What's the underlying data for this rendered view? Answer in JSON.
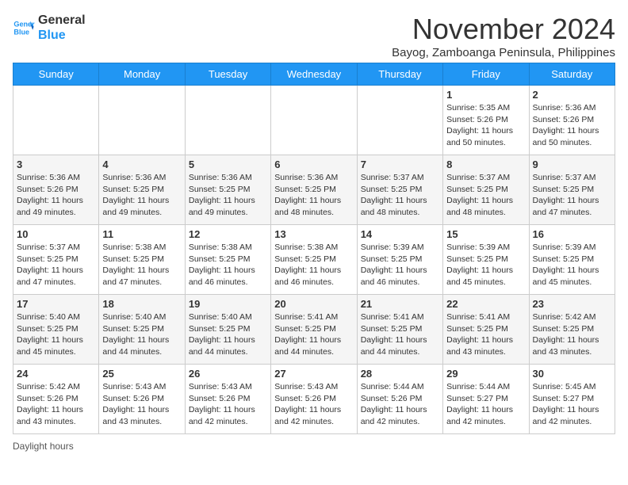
{
  "logo": {
    "line1": "General",
    "line2": "Blue"
  },
  "title": "November 2024",
  "subtitle": "Bayog, Zamboanga Peninsula, Philippines",
  "days_of_week": [
    "Sunday",
    "Monday",
    "Tuesday",
    "Wednesday",
    "Thursday",
    "Friday",
    "Saturday"
  ],
  "weeks": [
    [
      {
        "day": "",
        "info": ""
      },
      {
        "day": "",
        "info": ""
      },
      {
        "day": "",
        "info": ""
      },
      {
        "day": "",
        "info": ""
      },
      {
        "day": "",
        "info": ""
      },
      {
        "day": "1",
        "info": "Sunrise: 5:35 AM\nSunset: 5:26 PM\nDaylight: 11 hours\nand 50 minutes."
      },
      {
        "day": "2",
        "info": "Sunrise: 5:36 AM\nSunset: 5:26 PM\nDaylight: 11 hours\nand 50 minutes."
      }
    ],
    [
      {
        "day": "3",
        "info": "Sunrise: 5:36 AM\nSunset: 5:26 PM\nDaylight: 11 hours\nand 49 minutes."
      },
      {
        "day": "4",
        "info": "Sunrise: 5:36 AM\nSunset: 5:25 PM\nDaylight: 11 hours\nand 49 minutes."
      },
      {
        "day": "5",
        "info": "Sunrise: 5:36 AM\nSunset: 5:25 PM\nDaylight: 11 hours\nand 49 minutes."
      },
      {
        "day": "6",
        "info": "Sunrise: 5:36 AM\nSunset: 5:25 PM\nDaylight: 11 hours\nand 48 minutes."
      },
      {
        "day": "7",
        "info": "Sunrise: 5:37 AM\nSunset: 5:25 PM\nDaylight: 11 hours\nand 48 minutes."
      },
      {
        "day": "8",
        "info": "Sunrise: 5:37 AM\nSunset: 5:25 PM\nDaylight: 11 hours\nand 48 minutes."
      },
      {
        "day": "9",
        "info": "Sunrise: 5:37 AM\nSunset: 5:25 PM\nDaylight: 11 hours\nand 47 minutes."
      }
    ],
    [
      {
        "day": "10",
        "info": "Sunrise: 5:37 AM\nSunset: 5:25 PM\nDaylight: 11 hours\nand 47 minutes."
      },
      {
        "day": "11",
        "info": "Sunrise: 5:38 AM\nSunset: 5:25 PM\nDaylight: 11 hours\nand 47 minutes."
      },
      {
        "day": "12",
        "info": "Sunrise: 5:38 AM\nSunset: 5:25 PM\nDaylight: 11 hours\nand 46 minutes."
      },
      {
        "day": "13",
        "info": "Sunrise: 5:38 AM\nSunset: 5:25 PM\nDaylight: 11 hours\nand 46 minutes."
      },
      {
        "day": "14",
        "info": "Sunrise: 5:39 AM\nSunset: 5:25 PM\nDaylight: 11 hours\nand 46 minutes."
      },
      {
        "day": "15",
        "info": "Sunrise: 5:39 AM\nSunset: 5:25 PM\nDaylight: 11 hours\nand 45 minutes."
      },
      {
        "day": "16",
        "info": "Sunrise: 5:39 AM\nSunset: 5:25 PM\nDaylight: 11 hours\nand 45 minutes."
      }
    ],
    [
      {
        "day": "17",
        "info": "Sunrise: 5:40 AM\nSunset: 5:25 PM\nDaylight: 11 hours\nand 45 minutes."
      },
      {
        "day": "18",
        "info": "Sunrise: 5:40 AM\nSunset: 5:25 PM\nDaylight: 11 hours\nand 44 minutes."
      },
      {
        "day": "19",
        "info": "Sunrise: 5:40 AM\nSunset: 5:25 PM\nDaylight: 11 hours\nand 44 minutes."
      },
      {
        "day": "20",
        "info": "Sunrise: 5:41 AM\nSunset: 5:25 PM\nDaylight: 11 hours\nand 44 minutes."
      },
      {
        "day": "21",
        "info": "Sunrise: 5:41 AM\nSunset: 5:25 PM\nDaylight: 11 hours\nand 44 minutes."
      },
      {
        "day": "22",
        "info": "Sunrise: 5:41 AM\nSunset: 5:25 PM\nDaylight: 11 hours\nand 43 minutes."
      },
      {
        "day": "23",
        "info": "Sunrise: 5:42 AM\nSunset: 5:25 PM\nDaylight: 11 hours\nand 43 minutes."
      }
    ],
    [
      {
        "day": "24",
        "info": "Sunrise: 5:42 AM\nSunset: 5:26 PM\nDaylight: 11 hours\nand 43 minutes."
      },
      {
        "day": "25",
        "info": "Sunrise: 5:43 AM\nSunset: 5:26 PM\nDaylight: 11 hours\nand 43 minutes."
      },
      {
        "day": "26",
        "info": "Sunrise: 5:43 AM\nSunset: 5:26 PM\nDaylight: 11 hours\nand 42 minutes."
      },
      {
        "day": "27",
        "info": "Sunrise: 5:43 AM\nSunset: 5:26 PM\nDaylight: 11 hours\nand 42 minutes."
      },
      {
        "day": "28",
        "info": "Sunrise: 5:44 AM\nSunset: 5:26 PM\nDaylight: 11 hours\nand 42 minutes."
      },
      {
        "day": "29",
        "info": "Sunrise: 5:44 AM\nSunset: 5:27 PM\nDaylight: 11 hours\nand 42 minutes."
      },
      {
        "day": "30",
        "info": "Sunrise: 5:45 AM\nSunset: 5:27 PM\nDaylight: 11 hours\nand 42 minutes."
      }
    ]
  ],
  "footer": "Daylight hours"
}
